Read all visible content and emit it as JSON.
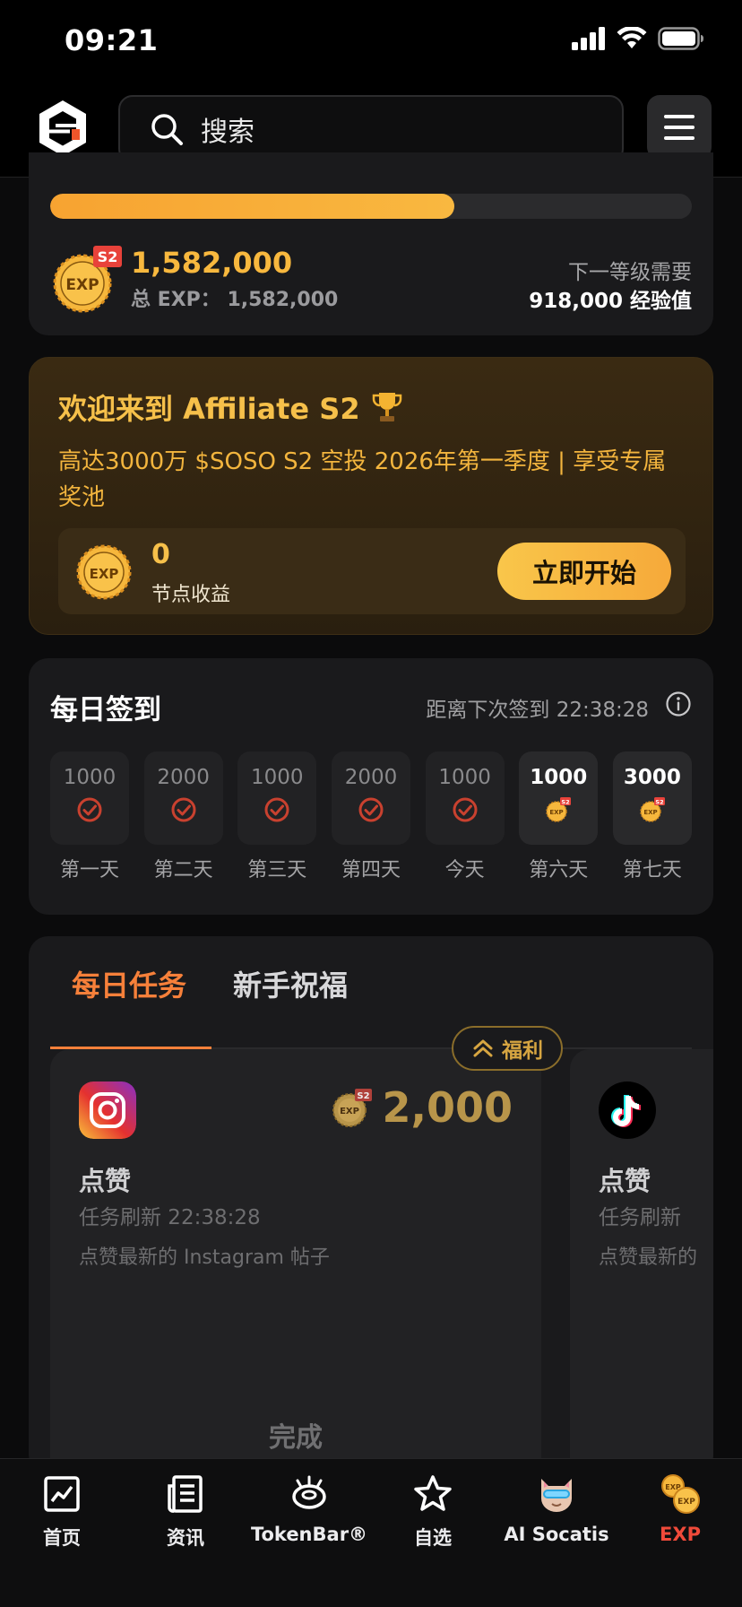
{
  "status_bar": {
    "time": "09:21"
  },
  "header": {
    "search_placeholder": "搜索"
  },
  "exp_summary": {
    "progress": 0.63,
    "value": "1,582,000",
    "total_label": "总 EXP：",
    "total_value": "1,582,000",
    "next_level_label": "下一等级需要",
    "next_level_value": "918,000 经验值",
    "badge_season": "S2",
    "badge_text": "EXP"
  },
  "affiliate": {
    "title": "欢迎来到 Affiliate S2",
    "title_icon": "trophy-icon",
    "description": "高达3000万 $SOSO S2 空投 2026年第一季度 | 享受专属奖池",
    "earnings_value": "0",
    "earnings_label": "节点收益",
    "start_button": "立即开始"
  },
  "daily_checkin": {
    "title": "每日签到",
    "countdown": "距离下次签到 22:38:28",
    "days": [
      {
        "amount": "1000",
        "label": "第一天",
        "claimed": true
      },
      {
        "amount": "2000",
        "label": "第二天",
        "claimed": true
      },
      {
        "amount": "1000",
        "label": "第三天",
        "claimed": true
      },
      {
        "amount": "2000",
        "label": "第四天",
        "claimed": true
      },
      {
        "amount": "1000",
        "label": "今天",
        "claimed": true
      },
      {
        "amount": "1000",
        "label": "第六天",
        "claimed": false
      },
      {
        "amount": "3000",
        "label": "第七天",
        "claimed": false
      }
    ]
  },
  "tasks": {
    "tabs": [
      {
        "label": "每日任务",
        "active": true
      },
      {
        "label": "新手祝福",
        "active": false
      }
    ],
    "welfare_badge": "福利",
    "items": [
      {
        "icon": "instagram-icon",
        "reward": "2,000",
        "name": "点赞",
        "refresh": "任务刷新 22:38:28",
        "description": "点赞最新的 Instagram 帖子",
        "status": "完成"
      },
      {
        "icon": "tiktok-icon",
        "name": "点赞",
        "refresh": "任务刷新",
        "description": "点赞最新的"
      }
    ]
  },
  "bottom_nav": [
    {
      "label": "首页",
      "icon": "chart-icon"
    },
    {
      "label": "资讯",
      "icon": "news-icon"
    },
    {
      "label": "TokenBar®",
      "icon": "tokenbar-icon"
    },
    {
      "label": "自选",
      "icon": "star-icon"
    },
    {
      "label": "AI Socatis",
      "icon": "cat-icon"
    },
    {
      "label": "EXP",
      "icon": "exp-coins-icon",
      "active": true
    }
  ],
  "colors": {
    "accent_orange": "#f6803a",
    "gold": "#f8b83e",
    "active_nav": "#f04a3a",
    "background": "#0b0b0c"
  }
}
